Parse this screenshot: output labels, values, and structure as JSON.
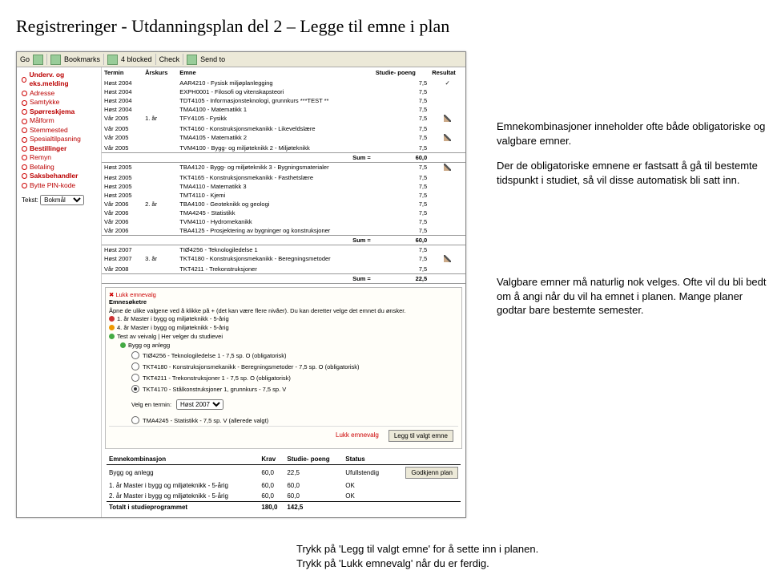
{
  "title": "Registreringer - Utdanningsplan del 2 – Legge til emne i plan",
  "toolbar": {
    "go": "Go",
    "bookmarks": "Bookmarks",
    "blocked": "4 blocked",
    "check": "Check",
    "sendto": "Send to"
  },
  "sidebar": {
    "items": [
      {
        "label": "Underv. og eks.melding",
        "bold": true
      },
      {
        "label": "Adresse",
        "bold": false
      },
      {
        "label": "Samtykke",
        "bold": false
      },
      {
        "label": "Spørreskjema",
        "bold": true
      },
      {
        "label": "Målform",
        "bold": false
      },
      {
        "label": "Stemmested",
        "bold": false
      },
      {
        "label": "Spesialtilpasning",
        "bold": false
      },
      {
        "label": "Bestillinger",
        "bold": true
      },
      {
        "label": "Remyn",
        "bold": false
      },
      {
        "label": "Betaling",
        "bold": false
      },
      {
        "label": "Saksbehandler",
        "bold": true
      },
      {
        "label": "Bytte PIN-kode",
        "bold": false
      }
    ],
    "tekst_label": "Tekst:",
    "tekst_value": "Bokmål"
  },
  "table": {
    "headers": [
      "Termin",
      "Årskurs",
      "Emne",
      "Studie-\npoeng",
      "Resultat"
    ],
    "groups": [
      {
        "year": "1. år",
        "rows": [
          {
            "term": "Høst 2004",
            "course": "AAR4210 - Fysisk miljøplanlegging",
            "sp": "7,5",
            "tick": true
          },
          {
            "term": "Høst 2004",
            "course": "EXPH0001 - Filosofi og vitenskapsteori",
            "sp": "7,5"
          },
          {
            "term": "Høst 2004",
            "course": "TDT4105 - Informasjonsteknologi, grunnkurs ***TEST **",
            "sp": "7,5"
          },
          {
            "term": "Høst 2004",
            "course": "TMA4100 - Matematikk 1",
            "sp": "7,5"
          },
          {
            "term": "Vår 2005",
            "course": "TFY4105 - Fysikk",
            "sp": "7,5",
            "edit": true
          },
          {
            "term": "Vår 2005",
            "course": "TKT4160 - Konstruksjonsmekanikk - Likeveldslære",
            "sp": "7,5"
          },
          {
            "term": "Vår 2005",
            "course": "TMA4105 - Matematikk 2",
            "sp": "7,5",
            "edit": true
          },
          {
            "term": "Vår 2005",
            "course": "TVM4100 - Bygg- og miljøteknikk 2 - Miljøteknikk",
            "sp": "7,5"
          }
        ],
        "sum": "60,0"
      },
      {
        "year": "2. år",
        "rows": [
          {
            "term": "Høst 2005",
            "course": "TBA4120 - Bygg- og miljøteknikk 3 - Bygningsmaterialer",
            "sp": "7,5",
            "edit": true
          },
          {
            "term": "Høst 2005",
            "course": "TKT4165 - Konstruksjonsmekanikk - Fasthetslære",
            "sp": "7,5"
          },
          {
            "term": "Høst 2005",
            "course": "TMA4110 - Matematikk 3",
            "sp": "7,5"
          },
          {
            "term": "Høst 2005",
            "course": "TMT4110 - Kjemi",
            "sp": "7,5"
          },
          {
            "term": "Vår 2006",
            "course": "TBA4100 - Geoteknikk og geologi",
            "sp": "7,5"
          },
          {
            "term": "Vår 2006",
            "course": "TMA4245 - Statistikk",
            "sp": "7,5"
          },
          {
            "term": "Vår 2006",
            "course": "TVM4110 - Hydromekanikk",
            "sp": "7,5"
          },
          {
            "term": "Vår 2006",
            "course": "TBA4125 - Prosjektering av bygninger og konstruksjoner",
            "sp": "7,5"
          }
        ],
        "sum": "60,0"
      },
      {
        "year": "3. år",
        "rows": [
          {
            "term": "Høst 2007",
            "course": "TIØ4256 - Teknologiledelse 1",
            "sp": "7,5"
          },
          {
            "term": "Høst 2007",
            "course": "TKT4180 - Konstruksjonsmekanikk - Beregningsmetoder",
            "sp": "7,5",
            "edit": true
          },
          {
            "term": "Vår 2008",
            "course": "TKT4211 - Trekonstruksjoner",
            "sp": "7,5"
          }
        ],
        "sum": "22,5"
      }
    ],
    "sum_label": "Sum ="
  },
  "box": {
    "close": "Lukk emnevalg",
    "header": "Emnesøketre",
    "intro": "Åpne de ulike valgene ved å klikke på + (det kan være flere nivåer). Du kan deretter velge det emnet du ønsker.",
    "tree": [
      {
        "color": "red",
        "text": "1. år Master i bygg og miljøteknikk - 5-årig",
        "level": 0
      },
      {
        "color": "orange",
        "text": "4. år Master i bygg og miljøteknikk - 5-årig",
        "level": 0
      },
      {
        "color": "green",
        "text": "Test av veivalg | Her velger du studievei",
        "level": 0
      },
      {
        "color": "green",
        "text": "Bygg og anlegg",
        "level": 1
      }
    ],
    "options": [
      {
        "text": "TIØ4256 - Teknologiledelse 1 - 7,5 sp. O (obligatorisk)",
        "on": false
      },
      {
        "text": "TKT4180 - Konstruksjonsmekanikk - Beregningsmetoder - 7,5 sp. O (obligatorisk)",
        "on": false
      },
      {
        "text": "TKT4211 - Trekonstruksjoner 1 - 7,5 sp. O (obligatorisk)",
        "on": false
      },
      {
        "text": "TKT4170 - Stålkonstruksjoner 1, grunnkurs - 7,5 sp. V",
        "on": true
      },
      {
        "text": "TMA4245 - Statistikk - 7,5 sp. V (allerede valgt)",
        "on": false
      }
    ],
    "select_label": "Velg en termin:",
    "select_value": "Høst 2007",
    "btn_close": "Lukk emnevalg",
    "btn_add": "Legg til valgt emne"
  },
  "bottom": {
    "headers": [
      "Emnekombinasjon",
      "Krav",
      "Studie-\npoeng",
      "Status",
      ""
    ],
    "rows": [
      {
        "name": "Bygg og anlegg",
        "krav": "60,0",
        "sp": "22,5",
        "status": "Ufullstendig"
      },
      {
        "name": "1. år Master i bygg og miljøteknikk - 5-årig",
        "krav": "60,0",
        "sp": "60,0",
        "status": "OK"
      },
      {
        "name": "2. år Master i bygg og miljøteknikk - 5-årig",
        "krav": "60,0",
        "sp": "60,0",
        "status": "OK"
      }
    ],
    "total_label": "Totalt i studieprogrammet",
    "total_krav": "180,0",
    "total_sp": "142,5",
    "godkjenn": "Godkjenn plan"
  },
  "callouts": {
    "c1a": "Emnekombinasjoner inneholder ofte både obligatoriske og valgbare emner.",
    "c1b": "Der de obligatoriske emnene er fastsatt å gå til bestemte tidspunkt i studiet, så vil disse automatisk bli satt inn.",
    "c2a": "Valgbare emner må naturlig nok velges. Ofte vil du bli bedt om å angi når du vil ha emnet i planen. Mange planer godtar bare bestemte semester."
  },
  "footer": {
    "l1": "Trykk på 'Legg til valgt emne' for å sette inn i planen.",
    "l2": "Trykk på 'Lukk emnevalg' når du er ferdig."
  }
}
